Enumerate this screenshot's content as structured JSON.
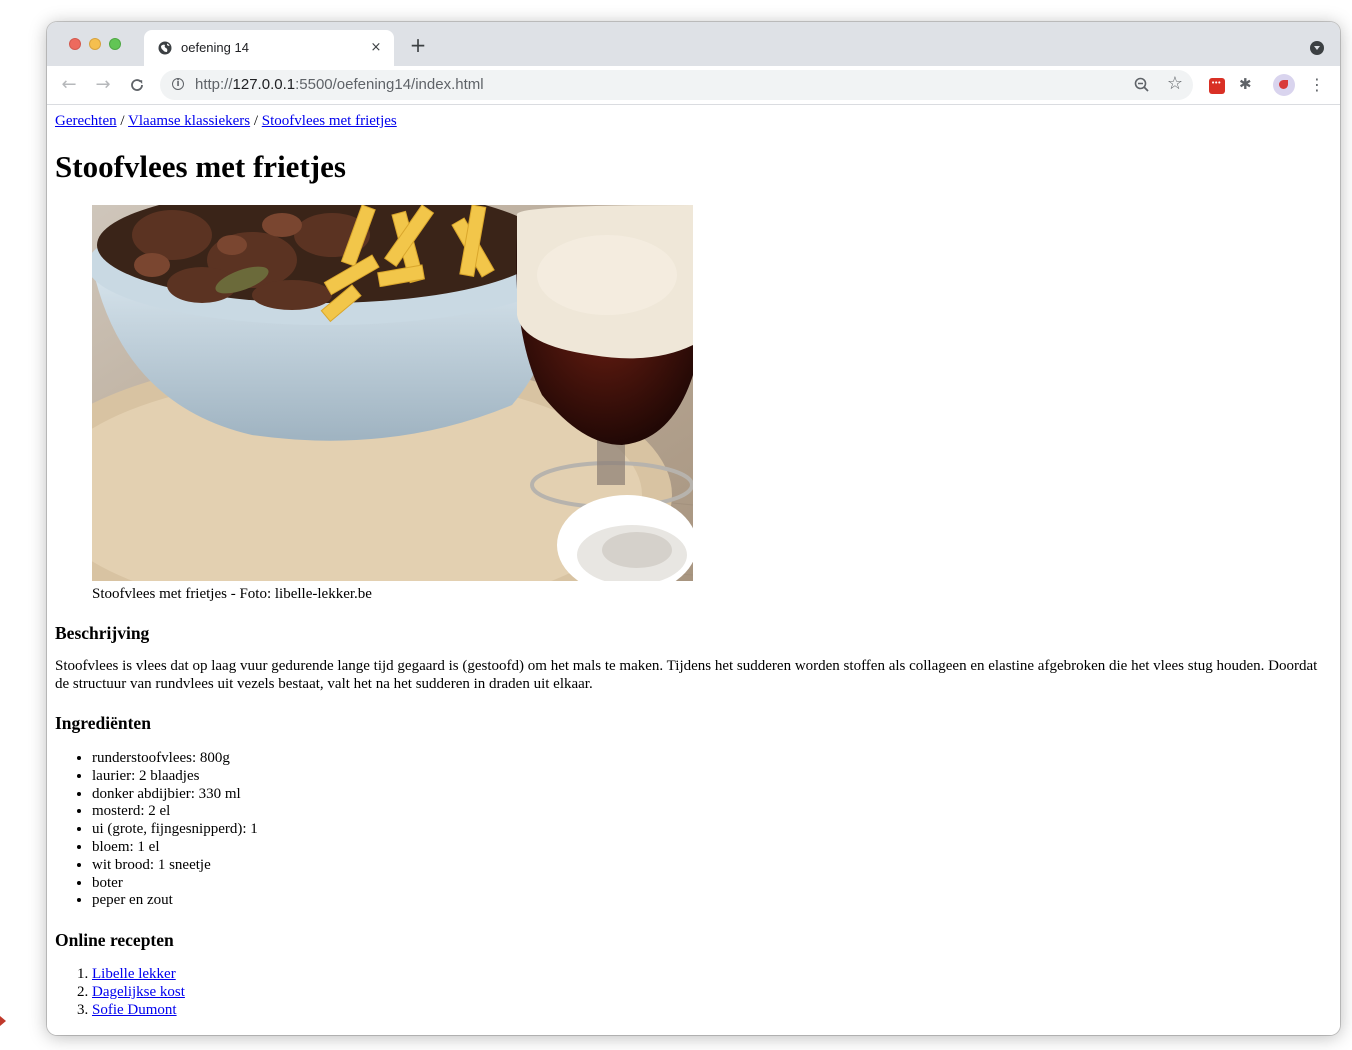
{
  "browser": {
    "tab_title": "oefening 14",
    "tab_close": "×",
    "new_tab": "+",
    "url_prefix": "http://",
    "url_host": "127.0.0.1",
    "url_rest": ":5500/oefening14/index.html",
    "nav": {
      "back": "←",
      "forward": "→",
      "reload": "C"
    },
    "star": "☆",
    "menu": "⋮",
    "puzzle": "✱"
  },
  "breadcrumb": {
    "items": [
      "Gerechten",
      "Vlaamse klassiekers",
      "Stoofvlees met frietjes"
    ],
    "separator": "/"
  },
  "title": "Stoofvlees met frietjes",
  "photo_caption": "Stoofvlees met frietjes - Foto: libelle-lekker.be",
  "description": {
    "heading": "Beschrijving",
    "text": "Stoofvlees is vlees dat op laag vuur gedurende lange tijd gegaard is (gestoofd) om het mals te maken. Tijdens het sudderen worden stoffen als collageen en elastine afgebroken die het vlees stug houden. Doordat de structuur van rundvlees uit vezels bestaat, valt het na het sudderen in draden uit elkaar."
  },
  "ingredients": {
    "heading": "Ingrediënten",
    "items": [
      "runderstoofvlees: 800g",
      "laurier: 2 blaadjes",
      "donker abdijbier: 330 ml",
      "mosterd: 2 el",
      "ui (grote, fijngesnipperd): 1",
      "bloem: 1 el",
      "wit brood: 1 sneetje",
      "boter",
      "peper en zout"
    ]
  },
  "online": {
    "heading": "Online recepten",
    "items": [
      "Libelle lekker",
      "Dagelijkse kost",
      "Sofie Dumont"
    ]
  }
}
